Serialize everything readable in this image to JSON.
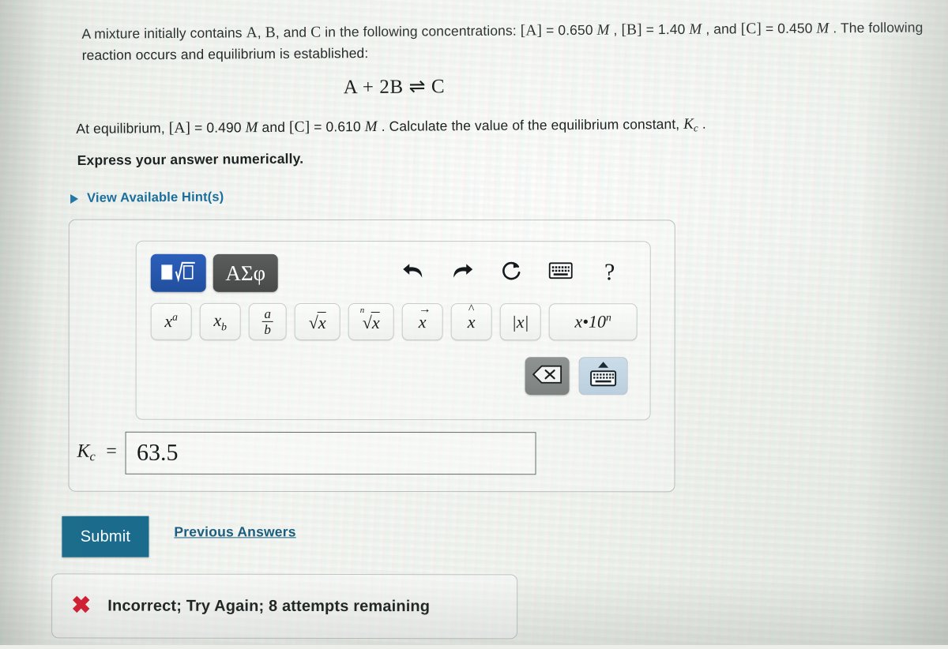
{
  "problem": {
    "statement_line1": "A mixture initially contains A, B, and C in the following concentrations: [A] = 0.650 M , [B] = 1.40 M , and [C] = 0.450 M . The following reaction occurs and equilibrium is established:",
    "equation": "A + 2B ⇌ C",
    "statement_line2": "At equilibrium, [A] = 0.490 M and [C] = 0.610 M . Calculate the value of the equilibrium constant, Kc .",
    "instruction": "Express your answer numerically.",
    "hints_label": "View Available Hint(s)",
    "hints_icon": "triangle-right-icon",
    "initial_concentrations": {
      "A": "0.650 M",
      "B": "1.40 M",
      "C": "0.450 M"
    },
    "equilibrium_concentrations": {
      "A": "0.490 M",
      "C": "0.610 M"
    }
  },
  "toolbar": {
    "formula_button": {
      "icon": "formula-template-icon",
      "label": "□√□",
      "active": true,
      "color": "#214f9e"
    },
    "greek_button": {
      "icon": "greek-letters-icon",
      "label": "ΑΣφ",
      "color": "#474a49"
    },
    "undo": {
      "icon": "undo-arrow-icon",
      "glyph": "⮨"
    },
    "redo": {
      "icon": "redo-arrow-icon",
      "glyph": "⮩"
    },
    "reset": {
      "icon": "reset-circular-arrow-icon",
      "glyph": "↻"
    },
    "keyboard": {
      "icon": "keyboard-icon",
      "glyph": "⌨"
    },
    "help": {
      "icon": "question-mark-icon",
      "glyph": "?"
    }
  },
  "symbols": [
    {
      "name": "power",
      "base": "x",
      "sup": "a"
    },
    {
      "name": "subscript",
      "base": "x",
      "sub": "b"
    },
    {
      "name": "fraction",
      "num": "a",
      "den": "b"
    },
    {
      "name": "square-root",
      "base": "x"
    },
    {
      "name": "nth-root",
      "index": "n",
      "base": "x"
    },
    {
      "name": "vector",
      "base": "x",
      "mark": "→"
    },
    {
      "name": "hat",
      "base": "x",
      "mark": "^"
    },
    {
      "name": "absolute-value",
      "label": "|x|"
    },
    {
      "name": "scientific-notation",
      "label": "x•10",
      "sup": "n"
    }
  ],
  "keypad": {
    "backspace": {
      "icon": "backspace-icon",
      "glyph": "⌫"
    },
    "keyboard_toggle": {
      "icon": "keyboard-up-icon",
      "glyph": "⌨",
      "arrow": "▲"
    }
  },
  "answer": {
    "label": "Kc",
    "label_base": "K",
    "label_sub": "c",
    "equals": "=",
    "value": "63.5",
    "placeholder": ""
  },
  "actions": {
    "submit_label": "Submit",
    "submit_color": "#1a6b8c",
    "previous_answers_label": "Previous Answers"
  },
  "feedback": {
    "icon": "red-x-icon",
    "glyph": "✖",
    "color": "#d8162c",
    "message": "Incorrect; Try Again; 8 attempts remaining",
    "attempts_remaining": 8
  }
}
